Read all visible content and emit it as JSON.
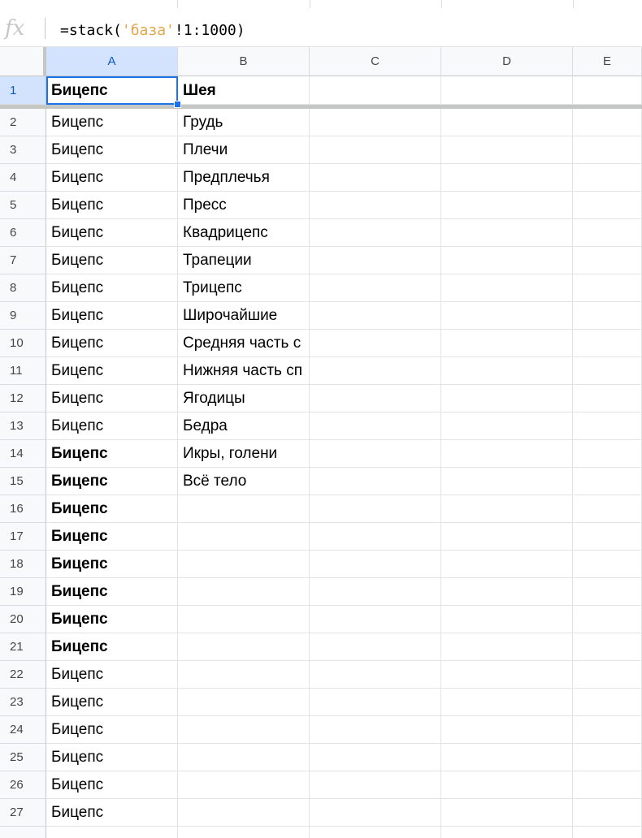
{
  "formula_bar": {
    "icon": "fx-icon",
    "formula_prefix": "=stack(",
    "formula_string": "'база'",
    "formula_suffix": "!1:1000)"
  },
  "columns": [
    "A",
    "B",
    "C",
    "D",
    "E"
  ],
  "selected_cell": "A1",
  "header_row": {
    "number": "1",
    "a": "Бицепс",
    "b": "Шея"
  },
  "rows": [
    {
      "n": "2",
      "a": "Бицепс",
      "b": "Грудь",
      "a_bold": false
    },
    {
      "n": "3",
      "a": "Бицепс",
      "b": "Плечи",
      "a_bold": false
    },
    {
      "n": "4",
      "a": "Бицепс",
      "b": "Предплечья",
      "a_bold": false
    },
    {
      "n": "5",
      "a": "Бицепс",
      "b": "Пресс",
      "a_bold": false
    },
    {
      "n": "6",
      "a": "Бицепс",
      "b": "Квадрицепс",
      "a_bold": false
    },
    {
      "n": "7",
      "a": "Бицепс",
      "b": "Трапеции",
      "a_bold": false
    },
    {
      "n": "8",
      "a": "Бицепс",
      "b": "Трицепс",
      "a_bold": false
    },
    {
      "n": "9",
      "a": "Бицепс",
      "b": "Широчайшие",
      "a_bold": false
    },
    {
      "n": "10",
      "a": "Бицепс",
      "b": "Средняя часть с",
      "a_bold": false
    },
    {
      "n": "11",
      "a": "Бицепс",
      "b": "Нижняя часть сп",
      "a_bold": false
    },
    {
      "n": "12",
      "a": "Бицепс",
      "b": "Ягодицы",
      "a_bold": false
    },
    {
      "n": "13",
      "a": "Бицепс",
      "b": "Бедра",
      "a_bold": false
    },
    {
      "n": "14",
      "a": "Бицепс",
      "b": "Икры, голени",
      "a_bold": true
    },
    {
      "n": "15",
      "a": "Бицепс",
      "b": "Всё тело",
      "a_bold": true
    },
    {
      "n": "16",
      "a": "Бицепс",
      "b": "",
      "a_bold": true
    },
    {
      "n": "17",
      "a": "Бицепс",
      "b": "",
      "a_bold": true
    },
    {
      "n": "18",
      "a": "Бицепс",
      "b": "",
      "a_bold": true
    },
    {
      "n": "19",
      "a": "Бицепс",
      "b": "",
      "a_bold": true
    },
    {
      "n": "20",
      "a": "Бицепс",
      "b": "",
      "a_bold": true
    },
    {
      "n": "21",
      "a": "Бицепс",
      "b": "",
      "a_bold": true
    },
    {
      "n": "22",
      "a": "Бицепс",
      "b": "",
      "a_bold": false
    },
    {
      "n": "23",
      "a": "Бицепс",
      "b": "",
      "a_bold": false
    },
    {
      "n": "24",
      "a": "Бицепс",
      "b": "",
      "a_bold": false
    },
    {
      "n": "25",
      "a": "Бицепс",
      "b": "",
      "a_bold": false
    },
    {
      "n": "26",
      "a": "Бицепс",
      "b": "",
      "a_bold": false
    },
    {
      "n": "27",
      "a": "Бицепс",
      "b": "",
      "a_bold": false
    }
  ],
  "colors": {
    "selection": "#1a73e8",
    "header_bg": "#f8f9fa",
    "formula_string": "#e3a548"
  }
}
